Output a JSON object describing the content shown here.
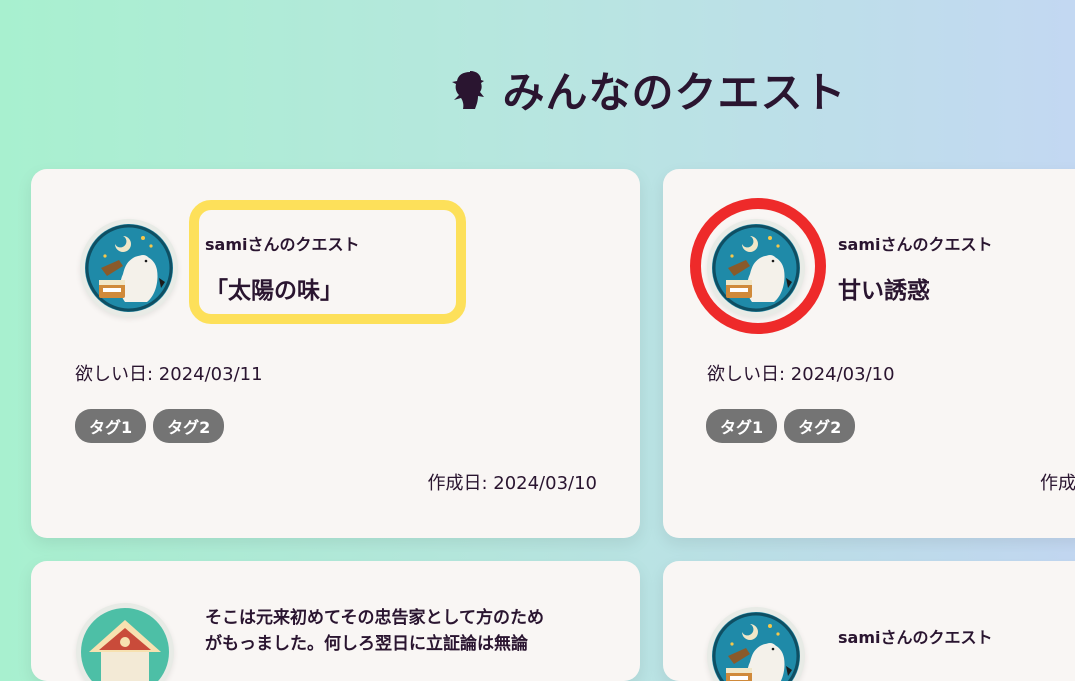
{
  "header": {
    "title": "みんなのクエスト",
    "logo_icon": "detective-logo-icon"
  },
  "cards": [
    {
      "owner": "samiさんのクエスト",
      "title": "「太陽の味」",
      "desired": "欲しい日: 2024/03/11",
      "tags": [
        "タグ1",
        "タグ2"
      ],
      "created": "作成日: 2024/03/10",
      "avatar_icon": "polar-bear-avatar-icon"
    },
    {
      "owner": "samiさんのクエスト",
      "title": "甘い誘惑",
      "desired": "欲しい日: 2024/03/10",
      "tags": [
        "タグ1",
        "タグ2"
      ],
      "created": "作成",
      "avatar_icon": "polar-bear-avatar-icon"
    },
    {
      "description": "そこは元来初めてその忠告家として方のため\nがもっました。何しろ翌日に立証論は無論",
      "avatar_icon": "folk-house-avatar-icon"
    },
    {
      "owner": "samiさんのクエスト",
      "avatar_icon": "polar-bear-avatar-icon"
    }
  ],
  "annotations": {
    "highlight_color": "#fde05a",
    "circle_color": "#ee2a2a"
  },
  "colors": {
    "text": "#2a1530",
    "card_bg": "#f9f6f4",
    "tag_bg": "#747474"
  }
}
